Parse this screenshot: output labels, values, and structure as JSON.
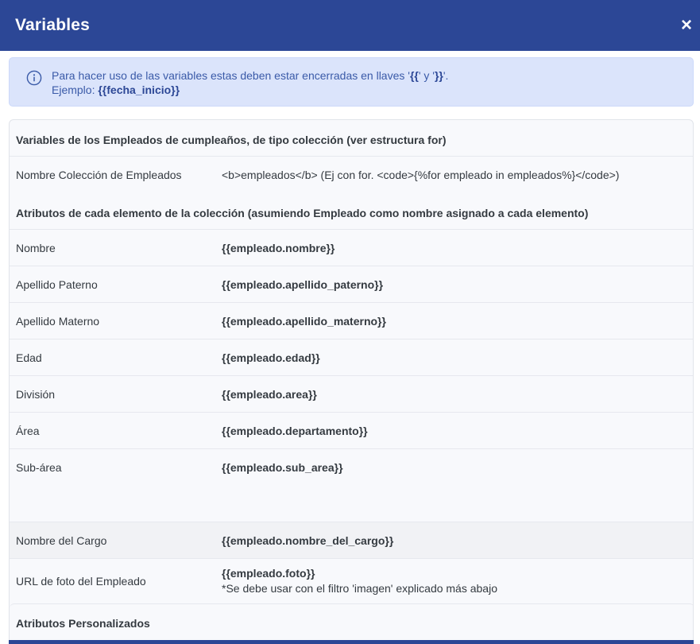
{
  "modal": {
    "title": "Variables",
    "close_symbol": "×"
  },
  "info": {
    "icon": "info-circle-icon",
    "line1_prefix": "Para hacer uso de las variables estas deben estar encerradas en llaves '",
    "open_braces": "{{",
    "line1_middle": "' y '",
    "close_braces": "}}",
    "line1_suffix": "'.",
    "line2_prefix": "Ejemplo: ",
    "example": "{{fecha_inicio}}"
  },
  "section1": {
    "title": "Variables de los Empleados de cumpleaños, de tipo colección (ver estructura for)",
    "collection": {
      "label": "Nombre Colección de Empleados",
      "value": "<b>empleados</b> (Ej con for. <code>{%for empleado in empleados%}</code>)"
    }
  },
  "section2": {
    "title": "Atributos de cada elemento de la colección (asumiendo Empleado como nombre asignado a cada elemento)",
    "rows": [
      {
        "label": "Nombre",
        "value": "{{empleado.nombre}}"
      },
      {
        "label": "Apellido Paterno",
        "value": "{{empleado.apellido_paterno}}"
      },
      {
        "label": "Apellido Materno",
        "value": "{{empleado.apellido_materno}}"
      },
      {
        "label": "Edad",
        "value": "{{empleado.edad}}"
      },
      {
        "label": "División",
        "value": "{{empleado.area}}"
      },
      {
        "label": "Área",
        "value": "{{empleado.departamento}}"
      },
      {
        "label": "Sub-área",
        "value": "{{empleado.sub_area}}"
      },
      {
        "label": "Nombre del Cargo",
        "value": "{{empleado.nombre_del_cargo}}"
      },
      {
        "label": "URL de foto del Empleado",
        "value": "{{empleado.foto}}",
        "note": "*Se debe usar con el filtro 'imagen' explicado más abajo"
      }
    ]
  },
  "section3": {
    "title": "Atributos Personalizados"
  },
  "colors": {
    "header": "#2c4796",
    "info_bg": "#dbe4fb",
    "info_text": "#3a5aa8"
  }
}
